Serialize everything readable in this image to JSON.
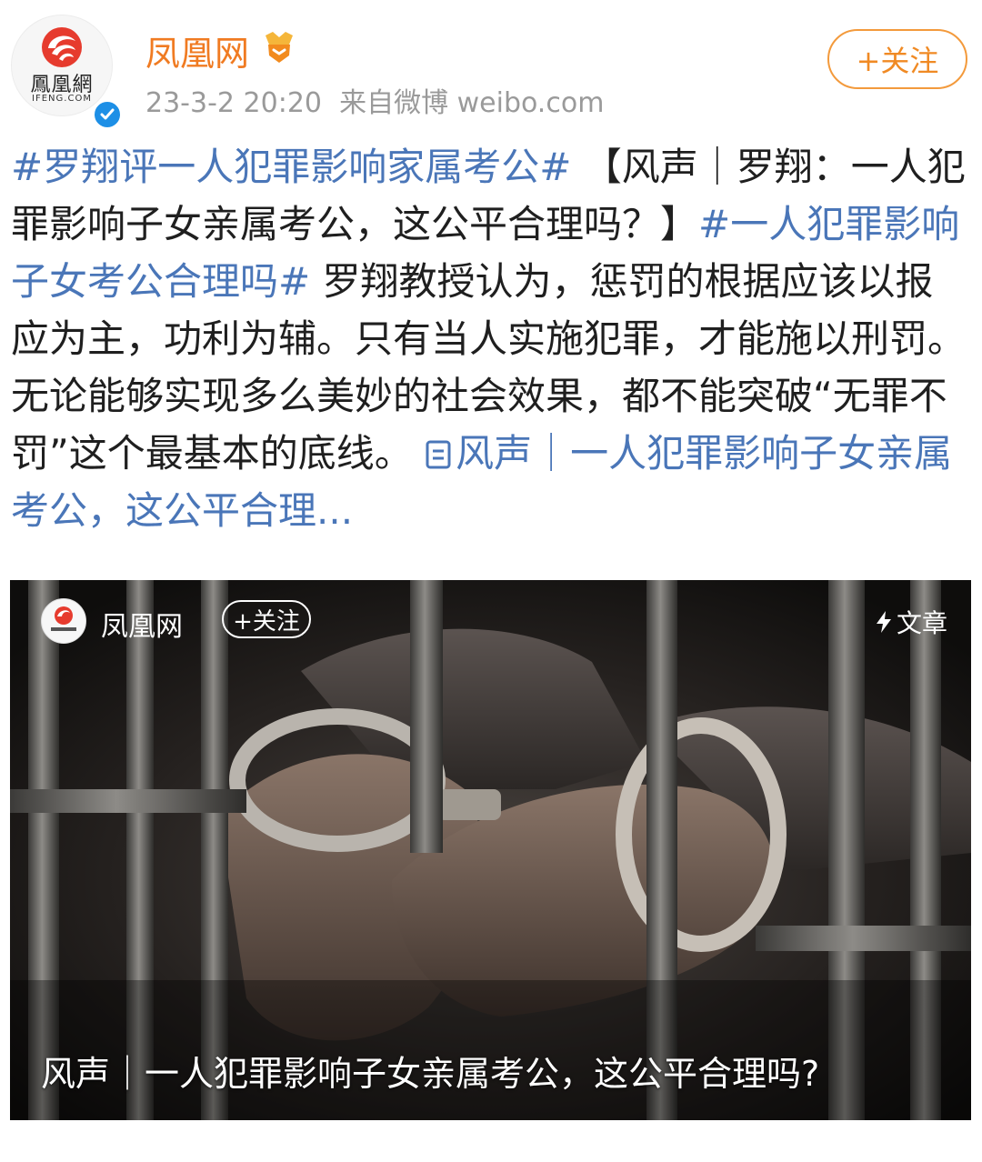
{
  "account": {
    "name": "凤凰网",
    "logo_text": "鳳凰網",
    "logo_sub": "IFENG.COM",
    "timestamp": "23-3-2 20:20",
    "source": "来自微博 weibo.com",
    "follow_label": "+关注"
  },
  "post": {
    "tag1": "#罗翔评一人犯罪影响家属考公#",
    "text1": " 【风声｜罗翔：一人犯罪影响子女亲属考公，这公平合理吗？】",
    "tag2": "#一人犯罪影响子女考公合理吗#",
    "text2": " 罗翔教授认为，惩罚的根据应该以报应为主，功利为辅。只有当人实施犯罪，才能施以刑罚。无论能够实现多么美妙的社会效果，都不能突破“无罪不罚”这个最基本的底线。",
    "link_text": "风声｜一人犯罪影响子女亲属考公，这公平合理..."
  },
  "card": {
    "account_name": "凤凰网",
    "follow_label": "+关注",
    "type_label": "文章",
    "caption": "风声｜一人犯罪影响子女亲属考公，这公平合理吗?",
    "icon_name": "lightning-icon"
  },
  "colors": {
    "brand_orange": "#f07b22",
    "link_blue": "#4a76b8",
    "verified_blue": "#1d8fe6"
  }
}
